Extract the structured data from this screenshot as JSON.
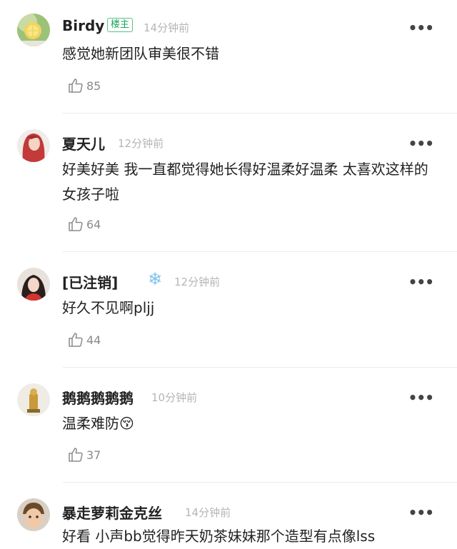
{
  "comments": [
    {
      "user": "Birdy",
      "badge": "楼主",
      "time": "14分钟前",
      "text": "感觉她新团队审美很不错",
      "likes": "85",
      "avatar_icon": "lemon-avatar"
    },
    {
      "user": "夏天儿",
      "time": "12分钟前",
      "text": "好美好美  我一直都觉得她长得好温柔好温柔 太喜欢这样的女孩子啦",
      "likes": "64",
      "avatar_icon": "red-hair-avatar"
    },
    {
      "user": "[已注销]",
      "time": "12分钟前",
      "text": "好久不见啊pljj",
      "likes": "44",
      "avatar_icon": "girl-avatar",
      "extra_icon": "snowflake-icon"
    },
    {
      "user": "鹅鹅鹅鹅鹅",
      "time": "10分钟前",
      "text": "温柔难防😚",
      "likes": "37",
      "avatar_icon": "figurine-avatar"
    },
    {
      "user": "暴走萝莉金克丝",
      "time": "14分钟前",
      "text": "好看 小声bb觉得昨天奶茶妹妹那个造型有点像lss",
      "avatar_icon": "child-avatar"
    }
  ],
  "more_glyph": "•••",
  "snow_glyph": "❄"
}
